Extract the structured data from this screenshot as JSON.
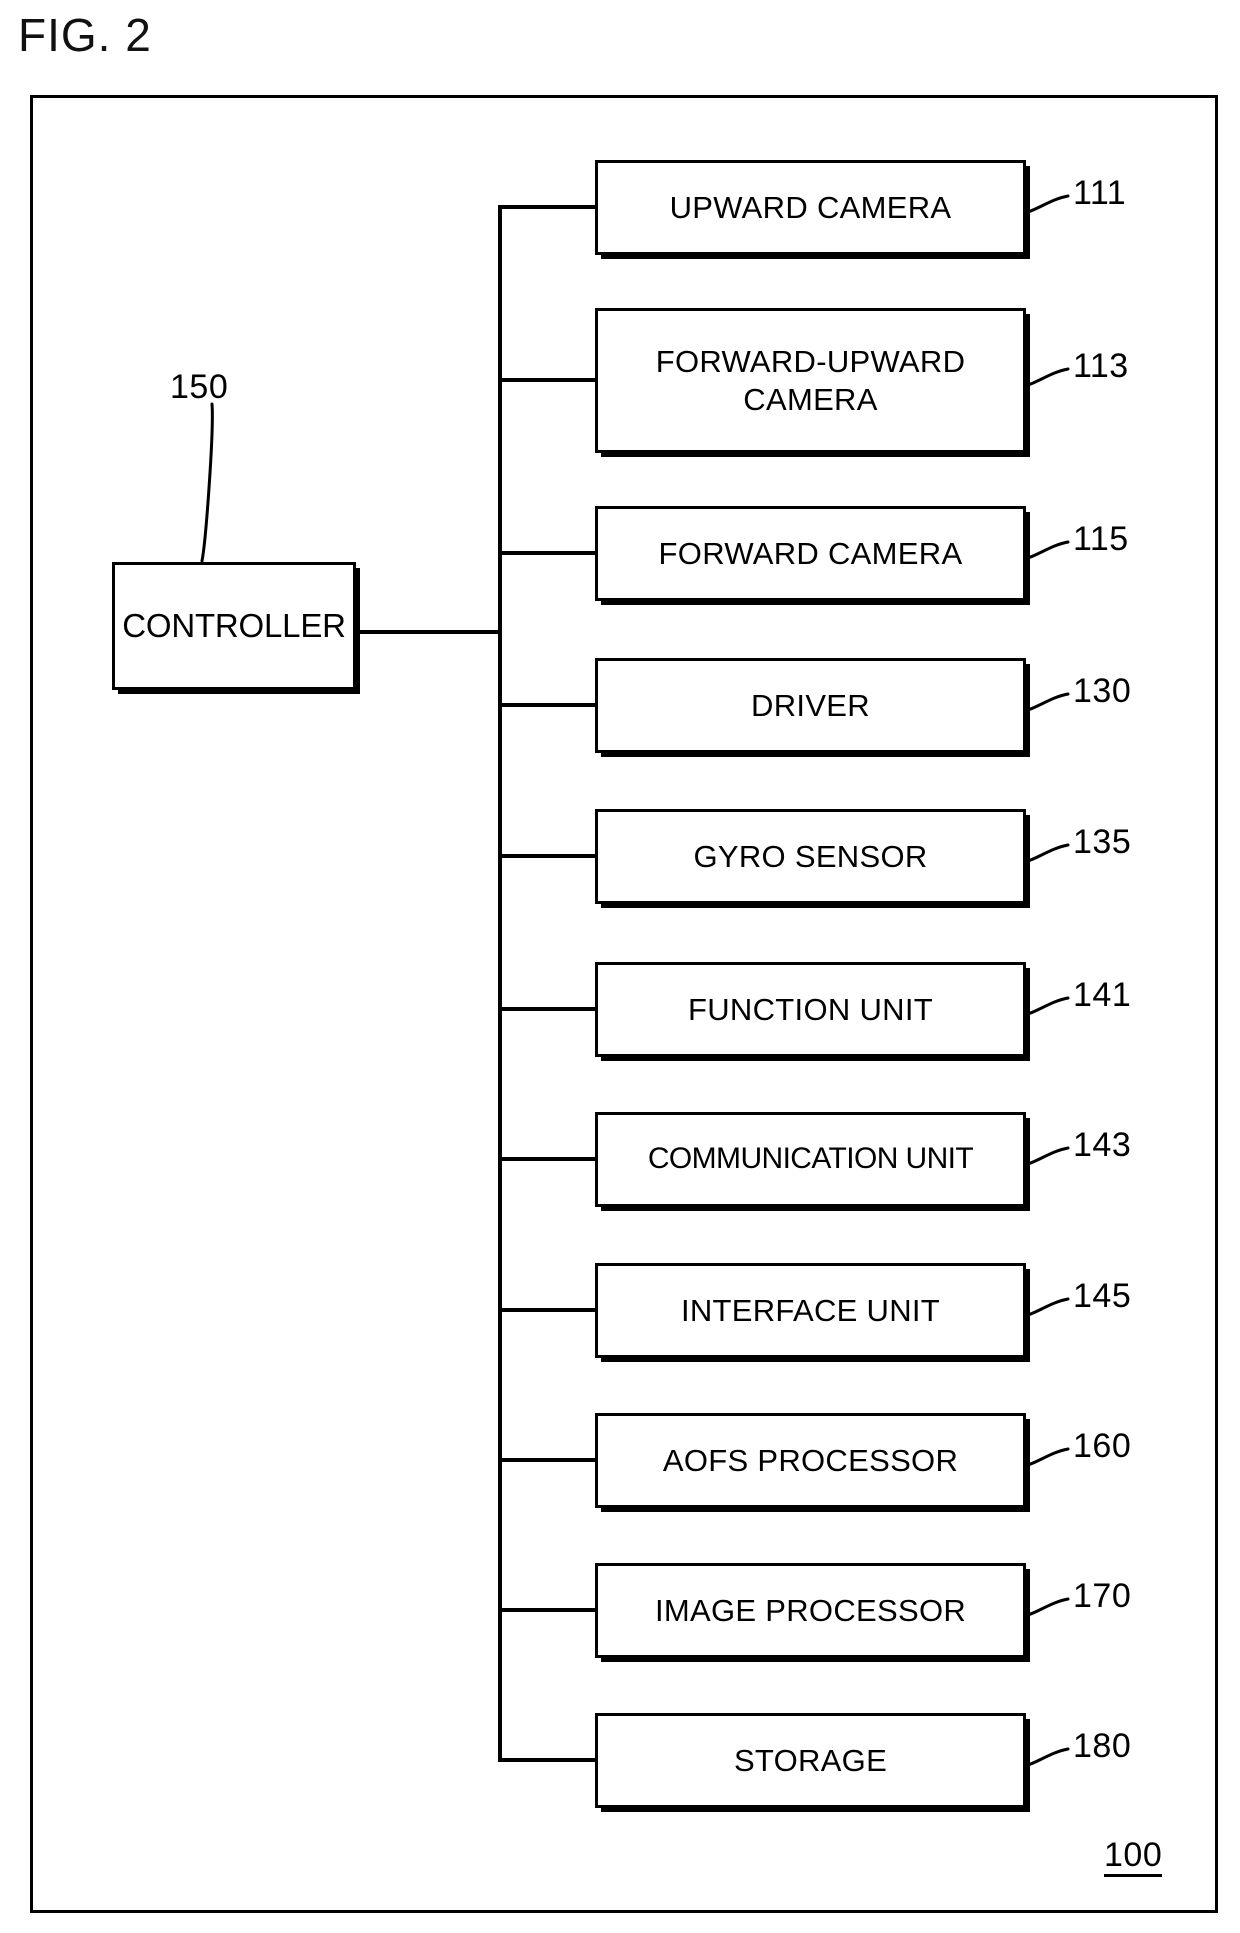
{
  "figure": {
    "label": "FIG. 2",
    "assembly_ref": "100"
  },
  "controller": {
    "label": "CONTROLLER",
    "ref": "150"
  },
  "blocks": [
    {
      "label": "UPWARD CAMERA",
      "ref": "111"
    },
    {
      "label": "FORWARD-UPWARD\nCAMERA",
      "ref": "113"
    },
    {
      "label": "FORWARD CAMERA",
      "ref": "115"
    },
    {
      "label": "DRIVER",
      "ref": "130"
    },
    {
      "label": "GYRO SENSOR",
      "ref": "135"
    },
    {
      "label": "FUNCTION UNIT",
      "ref": "141"
    },
    {
      "label": "COMMUNICATION UNIT",
      "ref": "143"
    },
    {
      "label": "INTERFACE UNIT",
      "ref": "145"
    },
    {
      "label": "AOFS PROCESSOR",
      "ref": "160"
    },
    {
      "label": "IMAGE PROCESSOR",
      "ref": "170"
    },
    {
      "label": "STORAGE",
      "ref": "180"
    }
  ]
}
